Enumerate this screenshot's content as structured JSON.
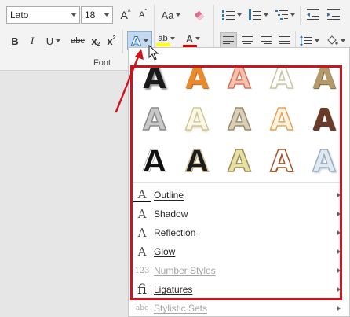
{
  "font": {
    "name_value": "Lato",
    "size_value": "18",
    "grow_label": "A",
    "shrink_label": "A",
    "case_label": "Aa",
    "bold_label": "B",
    "italic_label": "I",
    "underline_label": "U",
    "strike_label": "abc",
    "subscript_label": "x",
    "superscript_label": "x",
    "effects_label": "A",
    "highlight_label": "ab",
    "color_label": "A",
    "group_label": "Font"
  },
  "colors": {
    "accent_red": "#d0141c",
    "font_color_bar": "#e00000",
    "highlight_bar": "#ffff00",
    "effects_blue": "#2e75b6"
  },
  "text_effects_gallery": {
    "glyph": "A",
    "rows": [
      [
        {
          "style": "black-shadow"
        },
        {
          "style": "orange-gradient"
        },
        {
          "style": "salmon-outline"
        },
        {
          "style": "light-outline"
        },
        {
          "style": "olive-gradient"
        }
      ],
      [
        {
          "style": "gray-gradient"
        },
        {
          "style": "pale-yellow-outline"
        },
        {
          "style": "tan-outline"
        },
        {
          "style": "light-orange-outline"
        },
        {
          "style": "brown-gradient"
        }
      ],
      [
        {
          "style": "black-white-outline"
        },
        {
          "style": "black-tan-outline"
        },
        {
          "style": "yellow-gold-outline"
        },
        {
          "style": "brown-white-outline"
        },
        {
          "style": "light-blue-glass"
        }
      ]
    ]
  },
  "menu": {
    "items": [
      {
        "label": "Outline",
        "icon": "outline-icon",
        "glyph": "A",
        "disabled": false
      },
      {
        "label": "Shadow",
        "icon": "shadow-icon",
        "glyph": "A",
        "disabled": false
      },
      {
        "label": "Reflection",
        "icon": "reflection-icon",
        "glyph": "A",
        "disabled": false
      },
      {
        "label": "Glow",
        "icon": "glow-icon",
        "glyph": "A",
        "disabled": false
      },
      {
        "label": "Number Styles",
        "icon": "number-styles-icon",
        "glyph": "123",
        "disabled": true
      },
      {
        "label": "Ligatures",
        "icon": "ligatures-icon",
        "glyph": "fi",
        "disabled": false
      },
      {
        "label": "Stylistic Sets",
        "icon": "stylistic-sets-icon",
        "glyph": "abc",
        "disabled": true
      }
    ]
  }
}
